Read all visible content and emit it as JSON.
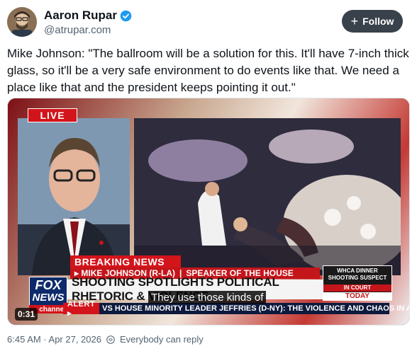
{
  "author": {
    "name": "Aaron Rupar",
    "handle": "@atrupar.com",
    "verified_icon": "verified-badge-icon"
  },
  "follow_button": {
    "label": "Follow",
    "icon": "plus-icon"
  },
  "tweet": {
    "text": "Mike Johnson: \"The ballroom will be a solution for this. It'll have 7-inch thick glass, so it'll be a very safe environment to do events like that. We need a place like that and the president keeps pointing it out.\""
  },
  "video": {
    "live_label": "LIVE",
    "breaking_label": "BREAKING NEWS",
    "nameplate": "▸ MIKE JOHNSON (R-LA)",
    "nameplate_title": "SPEAKER OF THE HOUSE",
    "headline": "SHOOTING SPOTLIGHTS POLITICAL RHETORIC & VIOLENCE",
    "logo_line1": "FOX",
    "logo_line2": "NEWS",
    "logo_sub": "channel",
    "alert_label": "ALERT ▸",
    "ticker": "VS HOUSE MINORITY LEADER JEFFRIES (D-NY): THE VIOLENCE AND CHAOS IN AM",
    "side_box_title": "WHCA DINNER SHOOTING SUSPECT",
    "side_box_status": "IN COURT",
    "side_box_when": "TODAY",
    "caption": "They use those kinds of",
    "duration": "0:31",
    "accent_red": "#d3141b",
    "fox_blue": "#0d2a6a"
  },
  "footer": {
    "timestamp": "6:45 AM · Apr 27, 2026",
    "reply_setting": "Everybody can reply",
    "reply_icon": "reply-settings-icon"
  }
}
